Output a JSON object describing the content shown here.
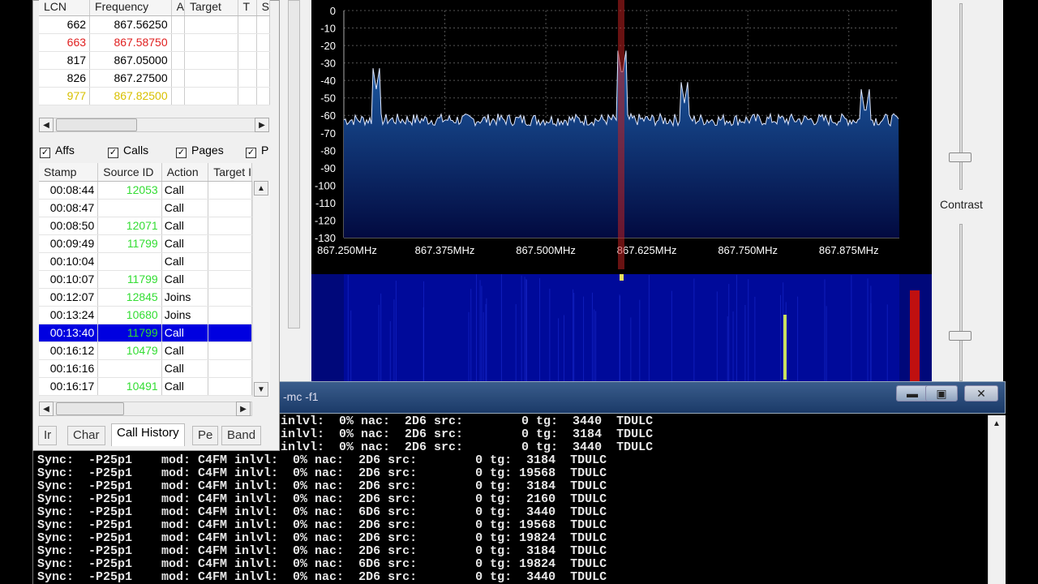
{
  "channels": {
    "headers": [
      "LCN",
      "Frequency",
      "A",
      "Target",
      "T",
      "S"
    ],
    "rows": [
      {
        "lcn": "662",
        "freq": "867.56250",
        "color": "#000000"
      },
      {
        "lcn": "663",
        "freq": "867.58750",
        "color": "#e02020"
      },
      {
        "lcn": "817",
        "freq": "867.05000",
        "color": "#000000"
      },
      {
        "lcn": "826",
        "freq": "867.27500",
        "color": "#000000"
      },
      {
        "lcn": "977",
        "freq": "867.82500",
        "color": "#d8c000"
      }
    ]
  },
  "filters": [
    {
      "label": "Affs",
      "checked": true
    },
    {
      "label": "Calls",
      "checked": true
    },
    {
      "label": "Pages",
      "checked": true
    },
    {
      "label": "P",
      "checked": true
    }
  ],
  "history": {
    "headers": [
      "Stamp",
      "Source ID",
      "Action",
      "Target I"
    ],
    "rows": [
      {
        "stamp": "00:08:44",
        "source": "12053",
        "action": "Call"
      },
      {
        "stamp": "00:08:47",
        "source": "",
        "action": "Call"
      },
      {
        "stamp": "00:08:50",
        "source": "12071",
        "action": "Call"
      },
      {
        "stamp": "00:09:49",
        "source": "11799",
        "action": "Call"
      },
      {
        "stamp": "00:10:04",
        "source": "",
        "action": "Call"
      },
      {
        "stamp": "00:10:07",
        "source": "11799",
        "action": "Call"
      },
      {
        "stamp": "00:12:07",
        "source": "12845",
        "action": "Joins"
      },
      {
        "stamp": "00:13:24",
        "source": "10680",
        "action": "Joins"
      },
      {
        "stamp": "00:13:40",
        "source": "11799",
        "action": "Call",
        "selected": true
      },
      {
        "stamp": "00:16:12",
        "source": "10479",
        "action": "Call"
      },
      {
        "stamp": "00:16:16",
        "source": "",
        "action": "Call"
      },
      {
        "stamp": "00:16:17",
        "source": "10491",
        "action": "Call"
      }
    ]
  },
  "tabs": [
    "Ir",
    "Char",
    "Call History",
    "Pe",
    "Band"
  ],
  "active_tab": "Call History",
  "spectrum": {
    "y_ticks": [
      "0",
      "-10",
      "-20",
      "-30",
      "-40",
      "-50",
      "-60",
      "-70",
      "-80",
      "-90",
      "-100",
      "-110",
      "-120",
      "-130"
    ],
    "x_ticks": [
      "867.250MHz",
      "867.375MHz",
      "867.500MHz",
      "867.625MHz",
      "867.750MHz",
      "867.875MHz"
    ],
    "fill_color": "#1e5fa8",
    "marker_color": "#c02020"
  },
  "contrast_label": "Contrast",
  "terminal": {
    "title": "-mc -f1",
    "top_lines": [
      "inlvl:  0% nac:  2D6 src:        0 tg:  3440  TDULC",
      "inlvl:  0% nac:  2D6 src:        0 tg:  3184  TDULC",
      "inlvl:  0% nac:  2D6 src:        0 tg:  3440  TDULC"
    ],
    "lines": [
      "Sync:  -P25p1    mod: C4FM inlvl:  0% nac:  2D6 src:        0 tg:  3184  TDULC",
      "Sync:  -P25p1    mod: C4FM inlvl:  0% nac:  2D6 src:        0 tg: 19568  TDULC",
      "Sync:  -P25p1    mod: C4FM inlvl:  0% nac:  2D6 src:        0 tg:  3184  TDULC",
      "Sync:  -P25p1    mod: C4FM inlvl:  0% nac:  2D6 src:        0 tg:  2160  TDULC",
      "Sync:  -P25p1    mod: C4FM inlvl:  0% nac:  6D6 src:        0 tg:  3440  TDULC",
      "Sync:  -P25p1    mod: C4FM inlvl:  0% nac:  2D6 src:        0 tg: 19568  TDULC",
      "Sync:  -P25p1    mod: C4FM inlvl:  0% nac:  2D6 src:        0 tg: 19824  TDULC",
      "Sync:  -P25p1    mod: C4FM inlvl:  0% nac:  2D6 src:        0 tg:  3184  TDULC",
      "Sync:  -P25p1    mod: C4FM inlvl:  0% nac:  6D6 src:        0 tg: 19824  TDULC",
      "Sync:  -P25p1    mod: C4FM inlvl:  0% nac:  2D6 src:        0 tg:  3440  TDULC"
    ]
  }
}
